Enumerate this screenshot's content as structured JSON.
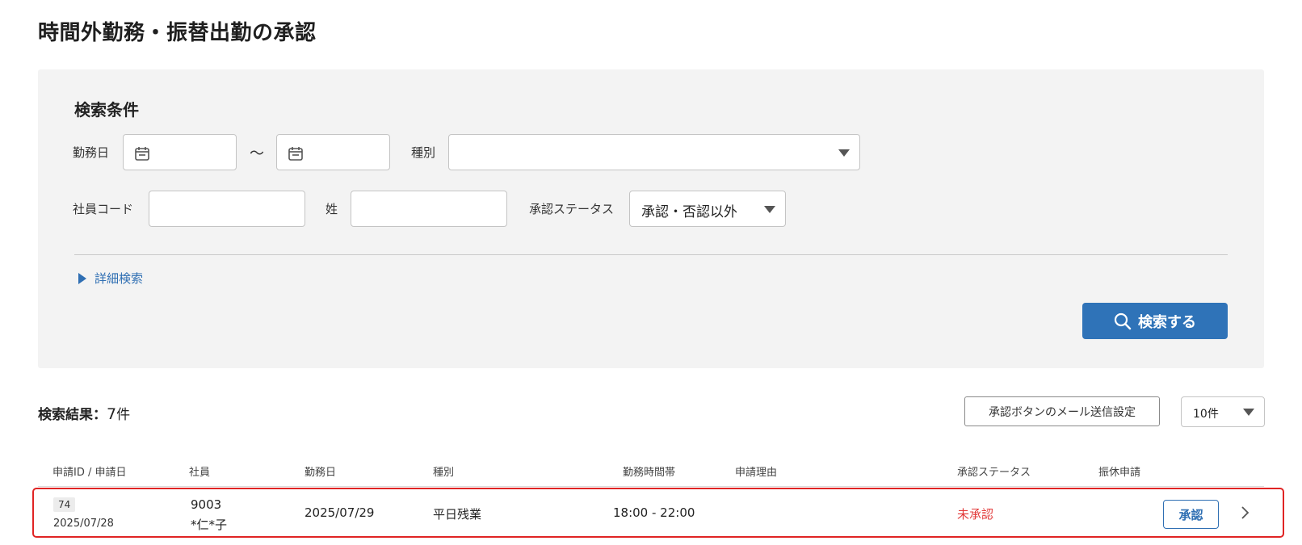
{
  "page": {
    "title": "時間外勤務・振替出勤の承認"
  },
  "search": {
    "heading": "検索条件",
    "work_date_label": "勤務日",
    "range_separator": "～",
    "type_label": "種別",
    "type_value": "",
    "employee_code_label": "社員コード",
    "employee_code_value": "",
    "last_name_label": "姓",
    "last_name_value": "",
    "approval_status_label": "承認ステータス",
    "approval_status_value": "承認・否認以外",
    "detail_search_label": "詳細検索",
    "search_button_label": "検索する"
  },
  "results": {
    "title": "検索結果",
    "separator": "：",
    "count": "7",
    "count_suffix": "件",
    "mail_setting_button_label": "承認ボタンのメール送信設定",
    "page_size_value": "10件",
    "columns": [
      "申請ID / 申請日",
      "社員",
      "勤務日",
      "種別",
      "勤務時間帯",
      "申請理由",
      "承認ステータス",
      "振休申請"
    ],
    "rows": [
      {
        "id": "74",
        "apply_date": "2025/07/28",
        "employee_code": "9003",
        "employee_name": "*仁*子",
        "work_date": "2025/07/29",
        "type": "平日残業",
        "time_range": "18:00 - 22:00",
        "reason": "",
        "status": "未承認",
        "approve_button_label": "承認"
      }
    ]
  },
  "colors": {
    "accent": "#2f73b8",
    "link": "#2f6fb3",
    "status_unapproved": "#e23b3b",
    "highlight_border": "#e02424",
    "panel_background": "#f3f3f3"
  },
  "icons": {
    "calendar": "calendar-icon",
    "search": "search-icon",
    "caret": "caret-down-icon",
    "expand": "triangle-right-icon",
    "row_open": "chevron-right-icon"
  }
}
